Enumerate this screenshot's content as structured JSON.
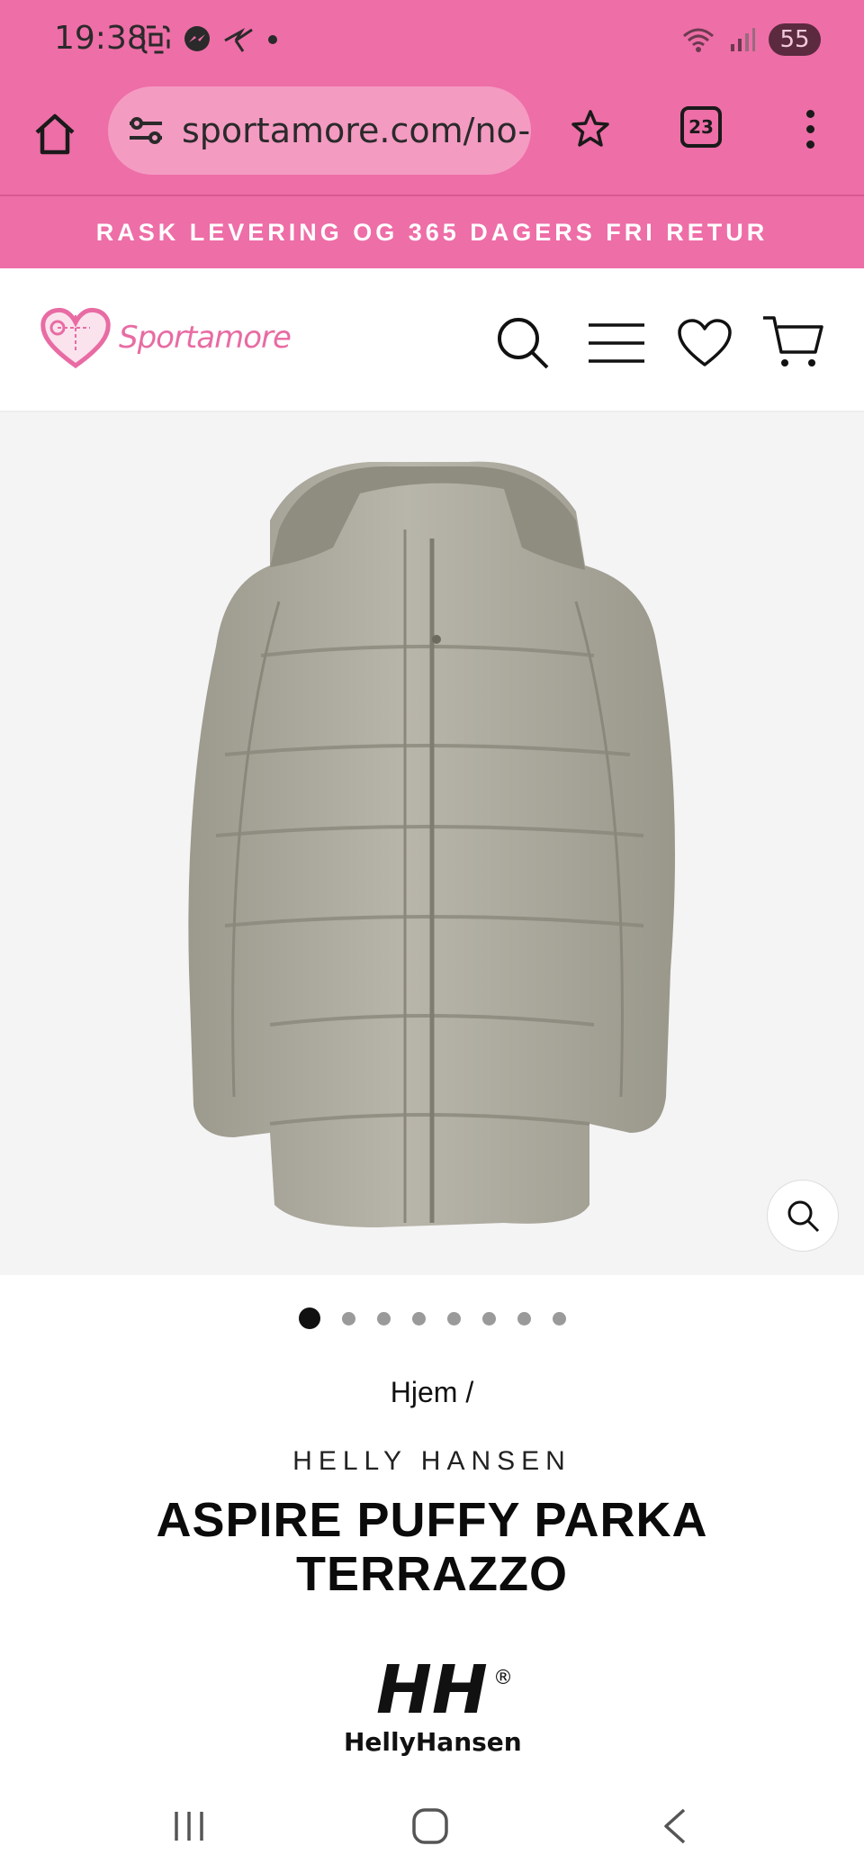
{
  "status_bar": {
    "time": "19:38",
    "battery": "55",
    "icons_left": [
      "screenshot-icon",
      "messenger-icon",
      "bird-app-icon",
      "dot-icon"
    ],
    "icons_right": [
      "wifi-icon",
      "signal-icon"
    ]
  },
  "browser": {
    "url": "sportamore.com/no-",
    "tab_count": "23",
    "theme_color": "#ee6ea7"
  },
  "promo": {
    "text": "RASK LEVERING OG 365 DAGERS FRI RETUR"
  },
  "site_header": {
    "logo_text": "Sportamore",
    "icons": [
      "search-icon",
      "menu-icon",
      "heart-icon",
      "cart-icon"
    ]
  },
  "product": {
    "image_dots_total": 8,
    "image_dots_active": 1,
    "breadcrumb": "Hjem /",
    "brand": "HELLY HANSEN",
    "title_line1": "ASPIRE PUFFY PARKA",
    "title_line2": "TERRAZZO",
    "brand_logo_mark": "HH",
    "brand_logo_name": "HellyHansen",
    "brand_logo_registered": "®",
    "jacket_color": "#aeaa9e"
  }
}
